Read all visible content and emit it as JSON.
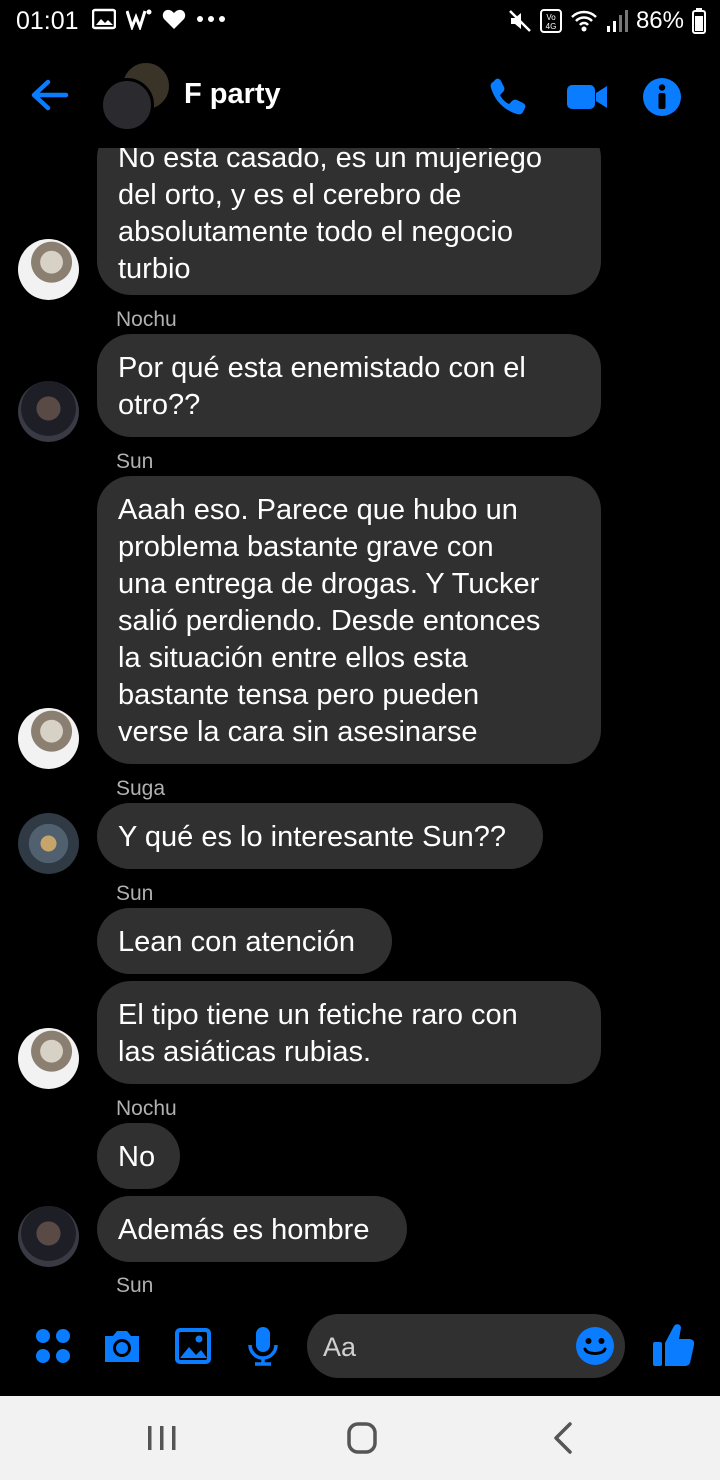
{
  "status_bar": {
    "time": "01:01",
    "battery": "86%",
    "icons_left": [
      "gallery-icon",
      "w-app-icon",
      "heart-icon",
      "more-dots-icon"
    ],
    "icons_right": [
      "mute-icon",
      "volte-4g-icon",
      "wifi-icon",
      "signal-icon",
      "battery-icon"
    ]
  },
  "header": {
    "title": "F party",
    "accent_color": "#0A7CFF"
  },
  "messages": [
    {
      "type": "bubble",
      "lines": [
        "No esta casado, es un mujeriego",
        "del orto, y es el cerebro de",
        "absolutamente todo el negocio",
        "turbio"
      ],
      "avatar": "sun"
    },
    {
      "type": "sender",
      "name": "Nochu"
    },
    {
      "type": "bubble",
      "lines": [
        "Por qué esta enemistado con el",
        "otro??"
      ],
      "avatar": "nochu"
    },
    {
      "type": "sender",
      "name": "Sun"
    },
    {
      "type": "bubble",
      "lines": [
        "Aaah eso. Parece que hubo un",
        "problema bastante grave con",
        "una entrega de drogas. Y Tucker",
        "salió perdiendo. Desde entonces",
        "la situación entre ellos esta",
        "bastante tensa pero pueden",
        "verse la cara sin asesinarse"
      ],
      "avatar": "sun"
    },
    {
      "type": "sender",
      "name": "Suga"
    },
    {
      "type": "bubble",
      "lines": [
        "Y qué es lo interesante Sun??"
      ],
      "avatar": "suga"
    },
    {
      "type": "sender",
      "name": "Sun"
    },
    {
      "type": "bubble",
      "lines": [
        "Lean con atención"
      ]
    },
    {
      "type": "bubble",
      "lines": [
        "El tipo tiene un fetiche raro con",
        "las asiáticas rubias."
      ],
      "avatar": "sun"
    },
    {
      "type": "sender",
      "name": "Nochu"
    },
    {
      "type": "bubble",
      "lines": [
        "No"
      ]
    },
    {
      "type": "bubble",
      "lines": [
        "Además es hombre"
      ],
      "avatar": "nochu"
    },
    {
      "type": "sender",
      "name": "Sun"
    }
  ],
  "composer": {
    "placeholder": "Aa",
    "buttons": [
      "apps-icon",
      "camera-icon",
      "image-icon",
      "microphone-icon",
      "emoji-icon",
      "thumbs-up-icon"
    ]
  },
  "nav_bar": {
    "buttons": [
      "recents-icon",
      "home-icon",
      "back-icon"
    ]
  }
}
